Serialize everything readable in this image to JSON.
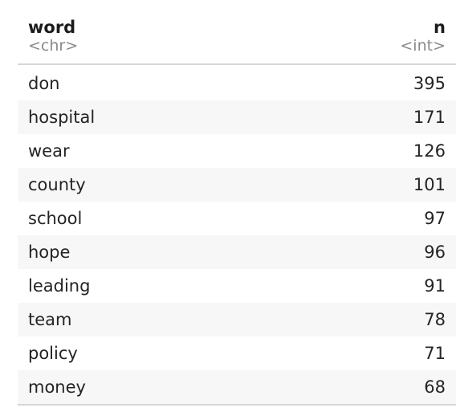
{
  "columns": [
    {
      "name": "word",
      "type": "<chr>"
    },
    {
      "name": "n",
      "type": "<int>"
    }
  ],
  "rows": [
    {
      "word": "don",
      "n": "395"
    },
    {
      "word": "hospital",
      "n": "171"
    },
    {
      "word": "wear",
      "n": "126"
    },
    {
      "word": "county",
      "n": "101"
    },
    {
      "word": "school",
      "n": "97"
    },
    {
      "word": "hope",
      "n": "96"
    },
    {
      "word": "leading",
      "n": "91"
    },
    {
      "word": "team",
      "n": "78"
    },
    {
      "word": "policy",
      "n": "71"
    },
    {
      "word": "money",
      "n": "68"
    }
  ]
}
